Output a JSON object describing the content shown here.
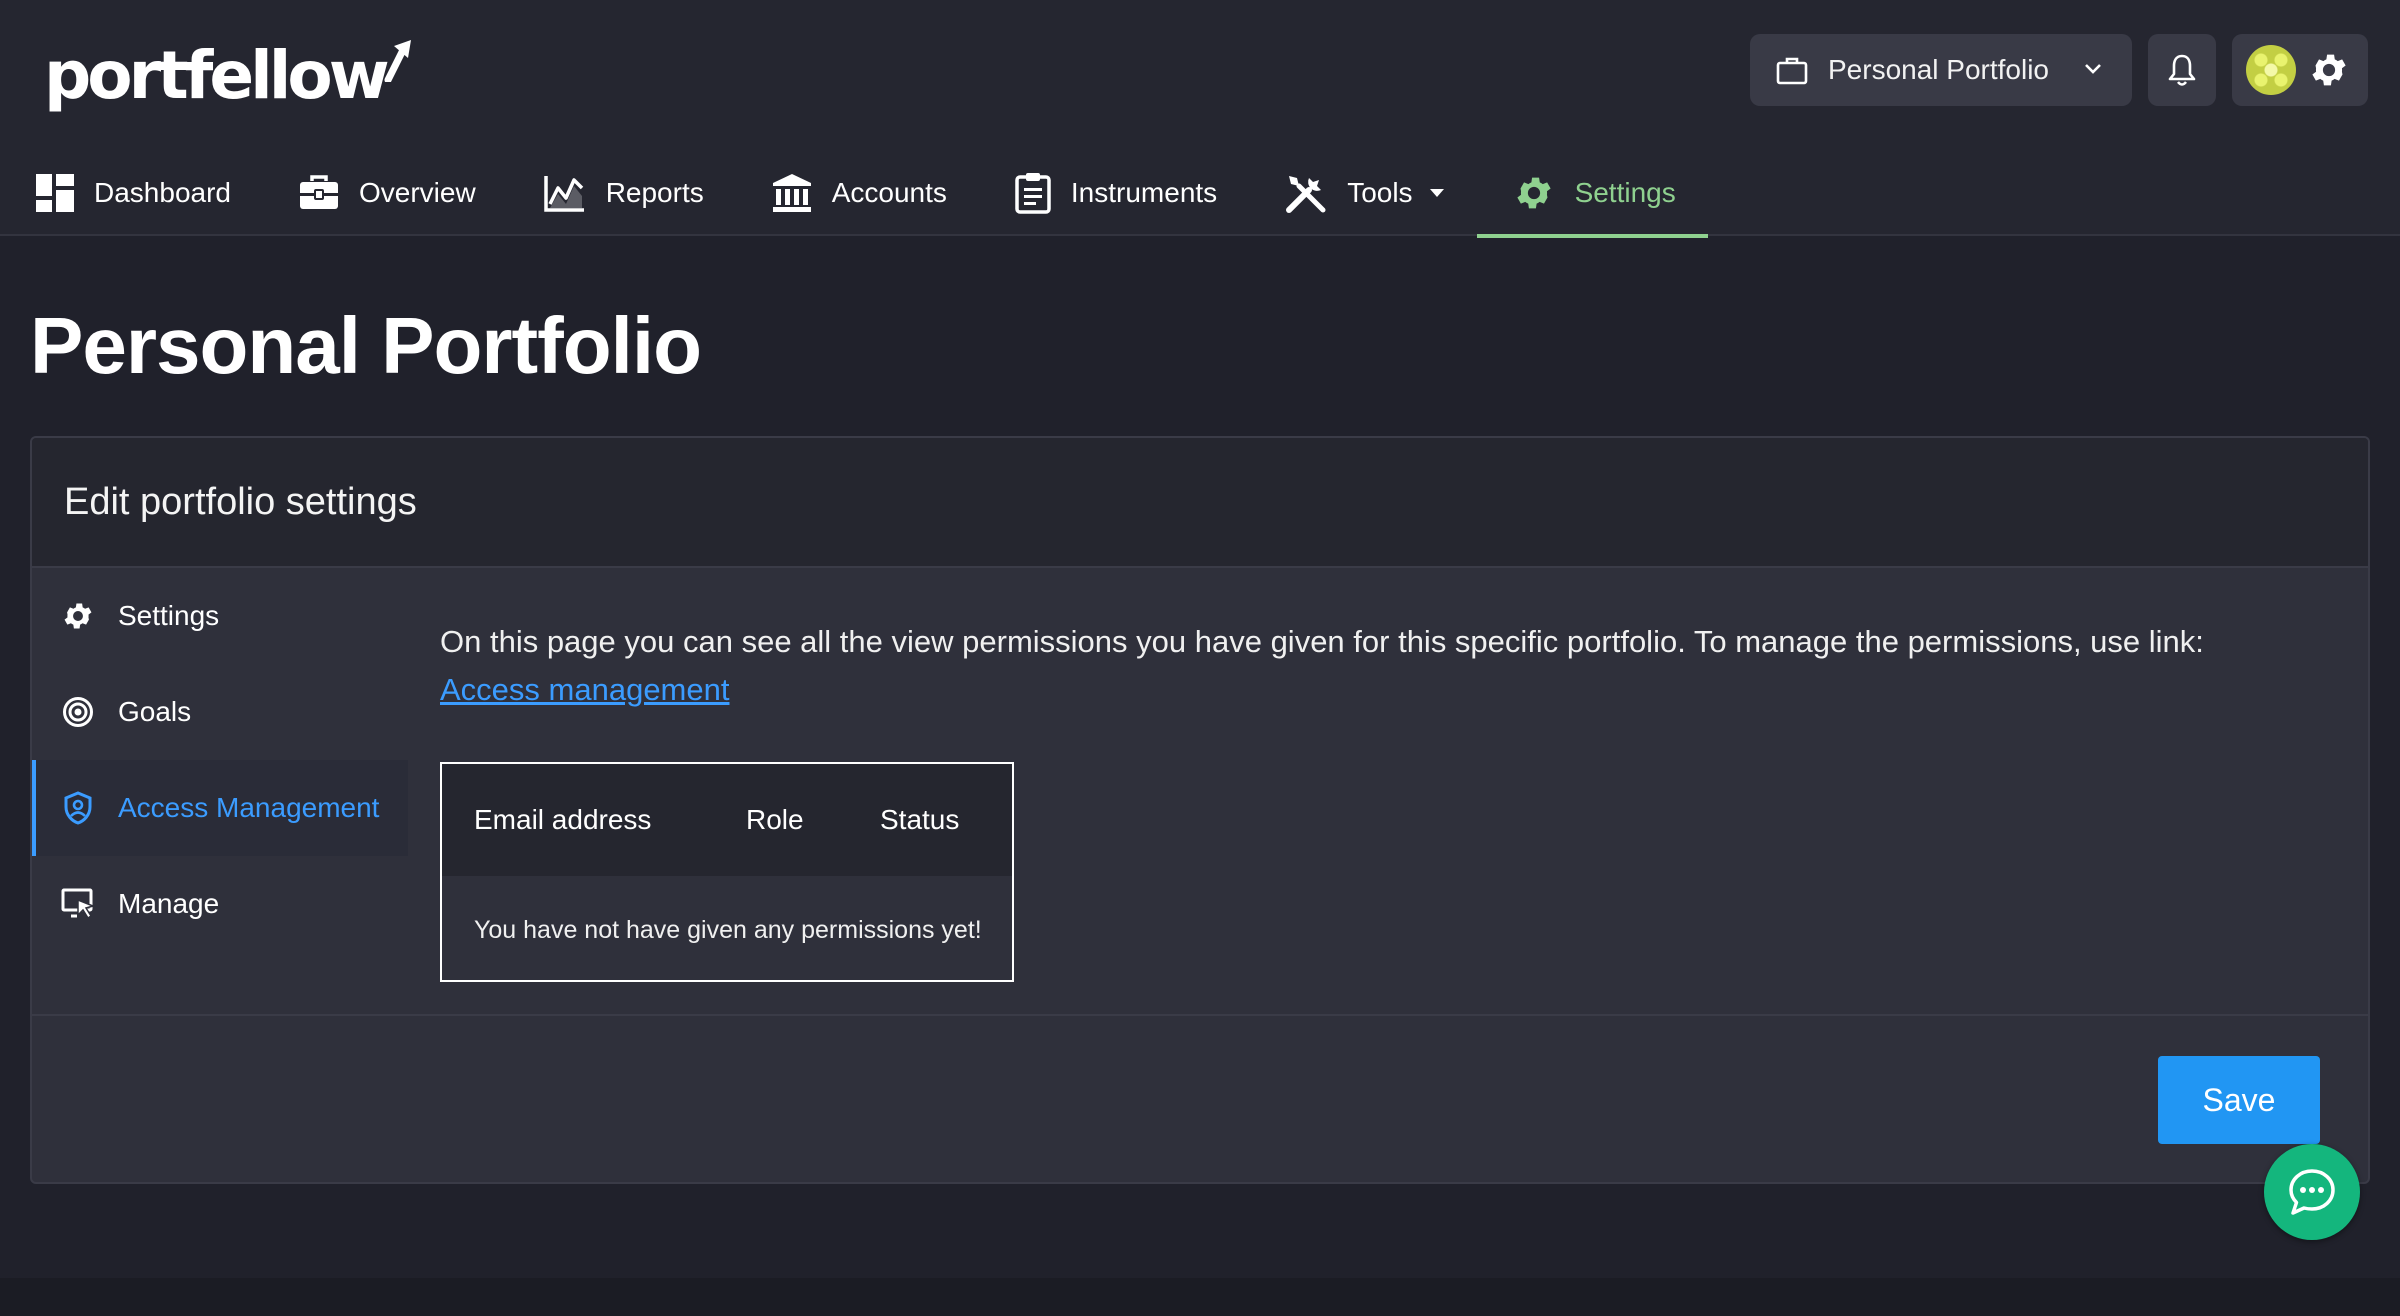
{
  "app": {
    "logo_text": "portfellow",
    "portfolio_selector": {
      "selected": "Personal Portfolio"
    }
  },
  "nav": {
    "items": [
      {
        "label": "Dashboard",
        "icon": "dashboard-icon"
      },
      {
        "label": "Overview",
        "icon": "briefcase-icon"
      },
      {
        "label": "Reports",
        "icon": "chart-line-icon"
      },
      {
        "label": "Accounts",
        "icon": "bank-icon"
      },
      {
        "label": "Instruments",
        "icon": "clipboard-icon"
      },
      {
        "label": "Tools",
        "icon": "tools-icon"
      },
      {
        "label": "Settings",
        "icon": "gear-icon",
        "active": true
      }
    ]
  },
  "page": {
    "title": "Personal Portfolio",
    "card_title": "Edit portfolio settings"
  },
  "sidebar": {
    "items": [
      {
        "label": "Settings",
        "icon": "gear-icon"
      },
      {
        "label": "Goals",
        "icon": "target-icon"
      },
      {
        "label": "Access Management",
        "icon": "shield-user-icon",
        "active": true
      },
      {
        "label": "Manage",
        "icon": "monitor-pointer-icon"
      }
    ]
  },
  "content": {
    "description": "On this page you can see all the view permissions you have given for this specific portfolio. To manage the permissions, use link:",
    "link_label": "Access management"
  },
  "permissions_table": {
    "headers": [
      "Email address",
      "Role",
      "Status"
    ],
    "empty_message": "You have not have given any permissions yet!"
  },
  "footer": {
    "save_label": "Save"
  },
  "colors": {
    "accent_blue": "#2196f3",
    "link_blue": "#3b9cff",
    "active_green": "#8fd18f",
    "chat_green": "#14b67d"
  }
}
